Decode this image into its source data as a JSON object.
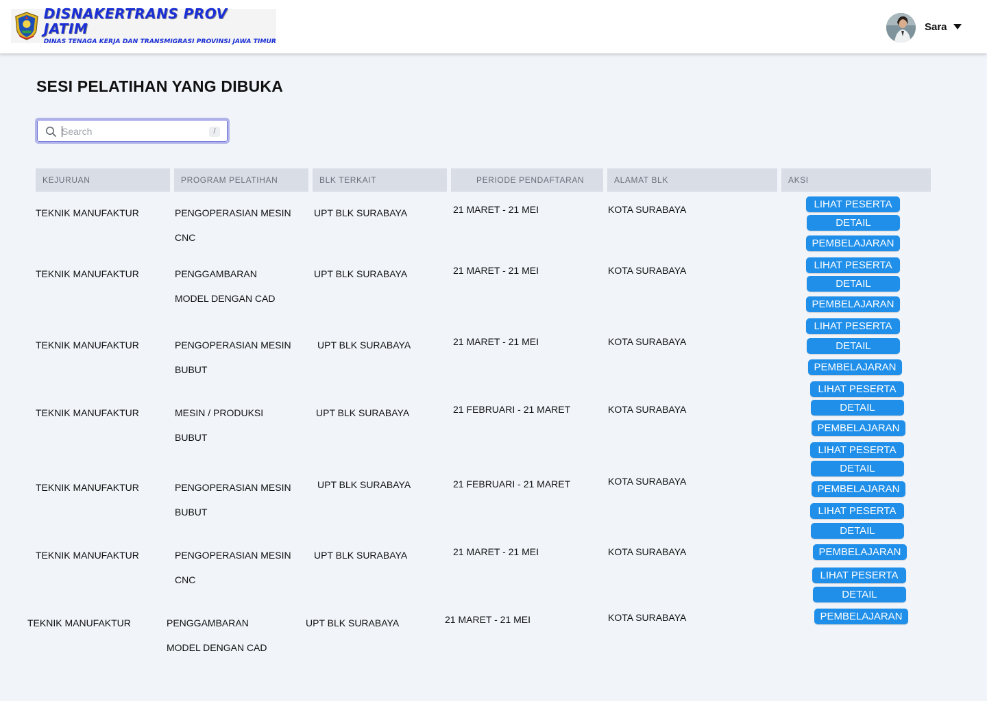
{
  "header": {
    "logo_title": "DISNAKERTRANS PROV JATIM",
    "logo_subtitle": "DINAS TENAGA KERJA DAN TRANSMIGRASI PROVINSI JAWA TIMUR",
    "user_name": "Sara"
  },
  "page": {
    "title": "SESI PELATIHAN YANG DIBUKA"
  },
  "search": {
    "placeholder": "Search",
    "shortcut": "/"
  },
  "table": {
    "headers": [
      "KEJURUAN",
      "PROGRAM PELATIHAN",
      "BLK TERKAIT",
      "PERIODE PENDAFTARAN",
      "ALAMAT BLK",
      "AKSI"
    ],
    "actions": {
      "lihat_peserta": "LIHAT PESERTA",
      "detail": "DETAIL",
      "pembelajaran": "PEMBELAJARAN"
    },
    "rows": [
      {
        "kejuruan": "TEKNIK MANUFAKTUR",
        "program": [
          "PENGOPERASIAN MESIN",
          "CNC"
        ],
        "blk": "UPT BLK SURABAYA",
        "periode": "21 MARET - 21 MEI",
        "alamat": "KOTA SURABAYA"
      },
      {
        "kejuruan": "TEKNIK MANUFAKTUR",
        "program": [
          "PENGGAMBARAN",
          "MODEL DENGAN CAD"
        ],
        "blk": "UPT BLK SURABAYA",
        "periode": "21 MARET - 21 MEI",
        "alamat": "KOTA SURABAYA"
      },
      {
        "kejuruan": "TEKNIK MANUFAKTUR",
        "program": [
          "PENGOPERASIAN MESIN",
          "BUBUT"
        ],
        "blk": "UPT BLK SURABAYA",
        "periode": "21 MARET - 21 MEI",
        "alamat": "KOTA SURABAYA"
      },
      {
        "kejuruan": "TEKNIK MANUFAKTUR",
        "program": [
          "MESIN / PRODUKSI",
          "BUBUT"
        ],
        "blk": "UPT BLK SURABAYA",
        "periode": "21 FEBRUARI - 21 MARET",
        "alamat": "KOTA SURABAYA"
      },
      {
        "kejuruan": "TEKNIK MANUFAKTUR",
        "program": [
          "PENGOPERASIAN MESIN",
          "BUBUT"
        ],
        "blk": "UPT BLK SURABAYA",
        "periode": "21 FEBRUARI - 21 MARET",
        "alamat": "KOTA SURABAYA"
      },
      {
        "kejuruan": "TEKNIK MANUFAKTUR",
        "program": [
          "PENGOPERASIAN MESIN",
          "CNC"
        ],
        "blk": "UPT BLK SURABAYA",
        "periode": "21 MARET - 21 MEI",
        "alamat": "KOTA SURABAYA"
      },
      {
        "kejuruan": "TEKNIK MANUFAKTUR",
        "program": [
          "PENGGAMBARAN",
          "MODEL DENGAN CAD"
        ],
        "blk": "UPT BLK SURABAYA",
        "periode": "21 MARET - 21 MEI",
        "alamat": "KOTA SURABAYA"
      }
    ]
  },
  "colors": {
    "button": "#1f8fea",
    "header_cell": "#d9dde6",
    "page_background": "#f1f4f9",
    "logo_text": "#1a2fd6"
  }
}
